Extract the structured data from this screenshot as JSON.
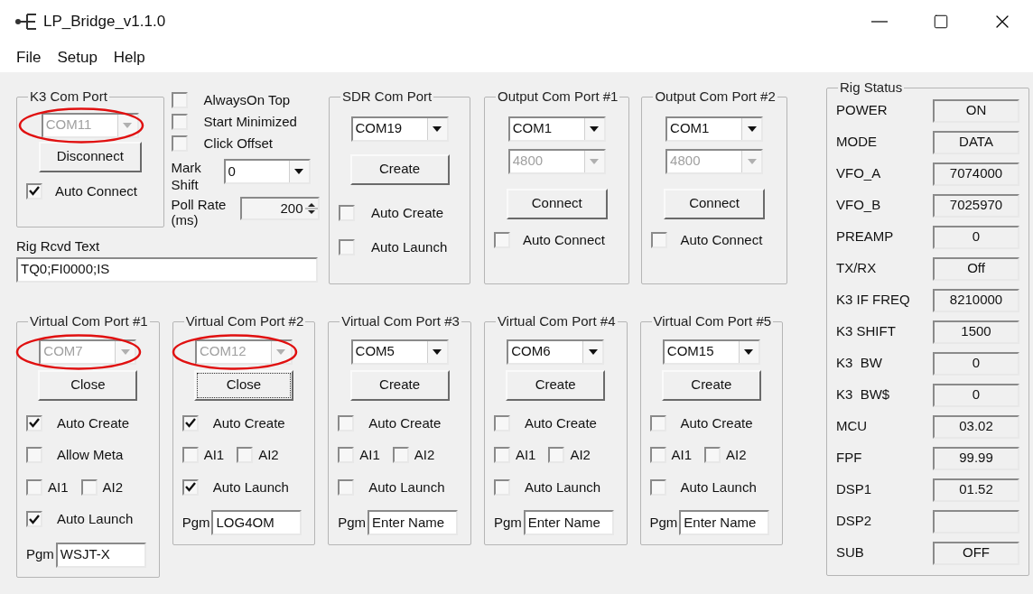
{
  "window": {
    "title": "LP_Bridge_v1.1.0"
  },
  "menu": [
    {
      "label": "File"
    },
    {
      "label": "Setup"
    },
    {
      "label": "Help"
    }
  ],
  "k3_port": {
    "title": "K3 Com Port",
    "port": {
      "value": "COM11",
      "disabled": true,
      "circled": true
    },
    "button": {
      "label": "Disconnect",
      "focused": false
    },
    "auto_connect": {
      "label": "Auto Connect",
      "checked": true
    }
  },
  "options": {
    "checkboxes": [
      {
        "label": "AlwaysOn Top",
        "checked": false
      },
      {
        "label": "Start Minimized",
        "checked": false
      },
      {
        "label": "Click Offset",
        "checked": false
      }
    ],
    "mark_shift": {
      "label": "Mark Shift",
      "value": "0"
    },
    "poll_rate": {
      "label": "Poll Rate (ms)",
      "value": "200"
    }
  },
  "rig_rcvd_text": {
    "label": "Rig Rcvd Text",
    "value": "TQ0;FI0000;IS"
  },
  "sdr_port": {
    "title": "SDR Com Port",
    "port": {
      "value": "COM19",
      "disabled": false,
      "circled": false
    },
    "button": {
      "label": "Create",
      "focused": false
    },
    "checkboxes": [
      {
        "label": "Auto Create",
        "checked": false
      },
      {
        "label": "Auto Launch",
        "checked": false
      }
    ]
  },
  "output_ports": [
    {
      "title": "Output Com Port #1",
      "port": {
        "value": "COM1",
        "disabled": false,
        "circled": false
      },
      "baud": {
        "value": "4800",
        "disabled": true,
        "circled": false
      },
      "button": {
        "label": "Connect",
        "focused": false
      },
      "auto_connect": {
        "label": "Auto Connect",
        "checked": false
      }
    },
    {
      "title": "Output Com Port #2",
      "port": {
        "value": "COM1",
        "disabled": false,
        "circled": false
      },
      "baud": {
        "value": "4800",
        "disabled": true,
        "circled": false
      },
      "button": {
        "label": "Connect",
        "focused": false
      },
      "auto_connect": {
        "label": "Auto Connect",
        "checked": false
      }
    }
  ],
  "virtual_ports": [
    {
      "title": "Virtual Com Port #1",
      "port": {
        "value": "COM7",
        "disabled": true,
        "circled": true
      },
      "button": {
        "label": "Close",
        "focused": false
      },
      "rows": [
        [
          {
            "label": "Auto Create",
            "checked": true
          }
        ],
        [
          {
            "label": "Allow Meta",
            "checked": false
          }
        ],
        [
          {
            "label": "AI1",
            "checked": false
          },
          {
            "label": "AI2",
            "checked": false
          }
        ],
        [
          {
            "label": "Auto Launch",
            "checked": true
          }
        ]
      ],
      "pgm": {
        "label": "Pgm",
        "value": "WSJT-X"
      }
    },
    {
      "title": "Virtual Com Port #2",
      "port": {
        "value": "COM12",
        "disabled": true,
        "circled": true
      },
      "button": {
        "label": "Close",
        "focused": true
      },
      "rows": [
        [
          {
            "label": "Auto Create",
            "checked": true
          }
        ],
        [
          {
            "label": "AI1",
            "checked": false
          },
          {
            "label": "AI2",
            "checked": false
          }
        ],
        [
          {
            "label": "Auto Launch",
            "checked": true
          }
        ]
      ],
      "pgm": {
        "label": "Pgm",
        "value": "LOG4OM"
      }
    },
    {
      "title": "Virtual Com Port #3",
      "port": {
        "value": "COM5",
        "disabled": false,
        "circled": false
      },
      "button": {
        "label": "Create",
        "focused": false
      },
      "rows": [
        [
          {
            "label": "Auto Create",
            "checked": false
          }
        ],
        [
          {
            "label": "AI1",
            "checked": false
          },
          {
            "label": "AI2",
            "checked": false
          }
        ],
        [
          {
            "label": "Auto Launch",
            "checked": false
          }
        ]
      ],
      "pgm": {
        "label": "Pgm",
        "value": "Enter Name"
      }
    },
    {
      "title": "Virtual Com Port #4",
      "port": {
        "value": "COM6",
        "disabled": false,
        "circled": false
      },
      "button": {
        "label": "Create",
        "focused": false
      },
      "rows": [
        [
          {
            "label": "Auto Create",
            "checked": false
          }
        ],
        [
          {
            "label": "AI1",
            "checked": false
          },
          {
            "label": "AI2",
            "checked": false
          }
        ],
        [
          {
            "label": "Auto Launch",
            "checked": false
          }
        ]
      ],
      "pgm": {
        "label": "Pgm",
        "value": "Enter Name"
      }
    },
    {
      "title": "Virtual Com Port #5",
      "port": {
        "value": "COM15",
        "disabled": false,
        "circled": false
      },
      "button": {
        "label": "Create",
        "focused": false
      },
      "rows": [
        [
          {
            "label": "Auto Create",
            "checked": false
          }
        ],
        [
          {
            "label": "AI1",
            "checked": false
          },
          {
            "label": "AI2",
            "checked": false
          }
        ],
        [
          {
            "label": "Auto Launch",
            "checked": false
          }
        ]
      ],
      "pgm": {
        "label": "Pgm",
        "value": "Enter Name"
      }
    }
  ],
  "rig_status": {
    "title": "Rig Status",
    "rows": [
      {
        "label": "POWER",
        "value": "ON"
      },
      {
        "label": "MODE",
        "value": "DATA"
      },
      {
        "label": "VFO_A",
        "value": "7074000"
      },
      {
        "label": "VFO_B",
        "value": "7025970"
      },
      {
        "label": "PREAMP",
        "value": "0"
      },
      {
        "label": "TX/RX",
        "value": "Off"
      },
      {
        "label": "K3 IF FREQ",
        "value": "8210000"
      },
      {
        "label": "K3 SHIFT",
        "value": "1500"
      },
      {
        "label": "K3  BW",
        "value": "0"
      },
      {
        "label": "K3  BW$",
        "value": "0"
      },
      {
        "label": "MCU",
        "value": "03.02"
      },
      {
        "label": "FPF",
        "value": "99.99"
      },
      {
        "label": "DSP1",
        "value": "01.52"
      },
      {
        "label": "DSP2"
      },
      {
        "label": "SUB",
        "value": "OFF"
      }
    ]
  }
}
